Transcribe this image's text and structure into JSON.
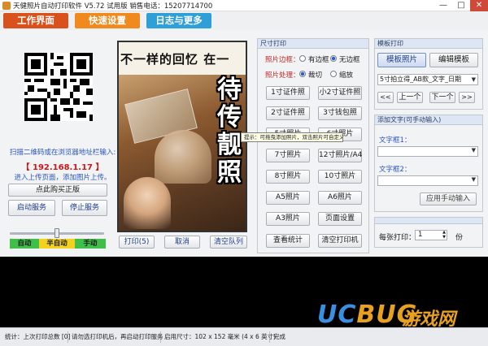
{
  "window": {
    "title": "天健照片自动打印软件 V5.72 试用版 销售电话：15207714700",
    "min": "—",
    "max": "□",
    "close": "✕"
  },
  "tabs": [
    {
      "label": "工作界面",
      "color": "#d9521e"
    },
    {
      "label": "快速设置",
      "color": "#f08a1e"
    },
    {
      "label": "日志与更多",
      "color": "#2f9fd8"
    }
  ],
  "left": {
    "scan_text": "扫描二维码或在浏览器地址栏输入:",
    "ip": "【 192.168.1.17 】",
    "upload_text": "进入上传页面，添加图片上传。",
    "buy_button": "点此购买正版",
    "start_service": "启动服务",
    "stop_service": "停止服务",
    "mode_labels": [
      "自动",
      "半自动",
      "手动"
    ],
    "mode_colors": [
      "#3fbf4a",
      "#f2d21e",
      "#3fbf4a"
    ],
    "mode_value_fraction": 0.5
  },
  "preview": {
    "heading": "不一样的回忆 在一",
    "vertical_chars": [
      "待",
      "传",
      "靓",
      "照"
    ],
    "print_button": "打印(5)",
    "cancel_button": "取消",
    "clear_button": "清空队列"
  },
  "size_panel": {
    "title": "尺寸打印",
    "border_label": "照片边框：",
    "border_options": [
      "有边框",
      "无边框"
    ],
    "border_selected": 1,
    "process_label": "照片处理：",
    "process_options": [
      "裁切",
      "缩放"
    ],
    "process_selected": 0,
    "sizes": [
      [
        "1寸证件照",
        "小2寸证件照"
      ],
      [
        "2寸证件照",
        "3寸钱包照"
      ],
      [
        "5寸照片",
        "6寸照片"
      ],
      [
        "7寸照片",
        "12寸照片/A4"
      ],
      [
        "8寸照片",
        "10寸照片"
      ],
      [
        "A5照片",
        "A6照片"
      ],
      [
        "A3照片",
        "页面设置"
      ]
    ],
    "stats_button": "查看统计",
    "clear_printer_button": "清空打印机"
  },
  "tooltip": "提示：可拖曳添加照片，双击照片可自定义裁剪!",
  "template_panel": {
    "title": "模板打印",
    "template_photo_button": "模板照片",
    "edit_template_button": "编辑模板",
    "select_value": "5寸拍立得_AB款_文字_日期",
    "first": "<<",
    "prev": "上一个",
    "next": "下一个",
    "last": ">>"
  },
  "text_panel": {
    "title": "添加文字(可手动输入)",
    "text1_label": "文字框1：",
    "text2_label": "文字框2：",
    "apply_button": "应用手动输入"
  },
  "copies": {
    "label": "每张打印：",
    "value": "1",
    "unit": "份"
  },
  "statusbar": {
    "stat": "统计：上次打印总数 [0]",
    "msg": "请勿选打印机后，再启动打印服务",
    "size": "启用尺寸：102 x 152 毫米 (4 x 6 英寸)",
    "done": "完成"
  },
  "watermark": {
    "brand_u": "UC",
    "brand_b": "BUG",
    "brand_cn": "游戏网"
  }
}
